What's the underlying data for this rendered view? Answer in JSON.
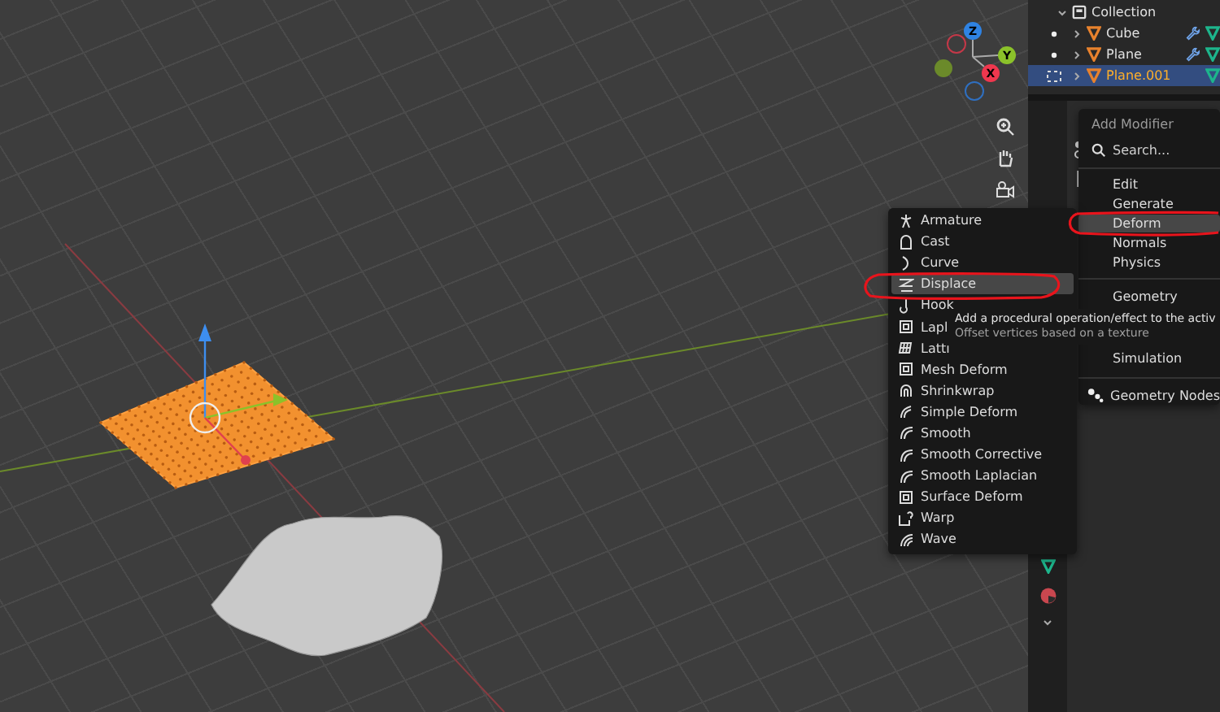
{
  "viewport": {
    "gizmo_axes": [
      {
        "label": "Z",
        "color": "#2f83e3"
      },
      {
        "label": "Y",
        "color": "#8bc22a"
      },
      {
        "label": "X",
        "color": "#f0374e"
      }
    ]
  },
  "outliner": {
    "collection": "Collection",
    "items": [
      {
        "name": "Cube",
        "selected": false
      },
      {
        "name": "Plane",
        "selected": false
      },
      {
        "name": "Plane.001",
        "selected": true
      }
    ]
  },
  "add_modifier_menu": {
    "title": "Add Modifier",
    "search": {
      "placeholder": "Search..."
    },
    "groups": [
      [
        {
          "label": "Edit",
          "selected": false
        },
        {
          "label": "Generate",
          "selected": false
        },
        {
          "label": "Deform",
          "selected": true
        },
        {
          "label": "Normals",
          "selected": false
        },
        {
          "label": "Physics",
          "selected": false
        }
      ],
      [
        {
          "label": "Geometry",
          "selected": false
        },
        {
          "label": "Simulation",
          "selected": false
        }
      ],
      [
        {
          "label": "Geometry Nodes",
          "selected": false
        }
      ]
    ]
  },
  "deform_submenu": {
    "items": [
      {
        "label": "Armature",
        "selected": false
      },
      {
        "label": "Cast",
        "selected": false
      },
      {
        "label": "Curve",
        "selected": false
      },
      {
        "label": "Displace",
        "selected": true
      },
      {
        "label": "Hook",
        "selected": false
      },
      {
        "label": "Lapl",
        "selected": false
      },
      {
        "label": "Latti",
        "selected": false
      },
      {
        "label": "Mesh Deform",
        "selected": false
      },
      {
        "label": "Shrinkwrap",
        "selected": false
      },
      {
        "label": "Simple Deform",
        "selected": false
      },
      {
        "label": "Smooth",
        "selected": false
      },
      {
        "label": "Smooth Corrective",
        "selected": false
      },
      {
        "label": "Smooth Laplacian",
        "selected": false
      },
      {
        "label": "Surface Deform",
        "selected": false
      },
      {
        "label": "Warp",
        "selected": false
      },
      {
        "label": "Wave",
        "selected": false
      }
    ]
  },
  "tooltip": {
    "lines": [
      "Add a procedural operation/effect to the activ",
      "Offset vertices based on a texture"
    ]
  }
}
